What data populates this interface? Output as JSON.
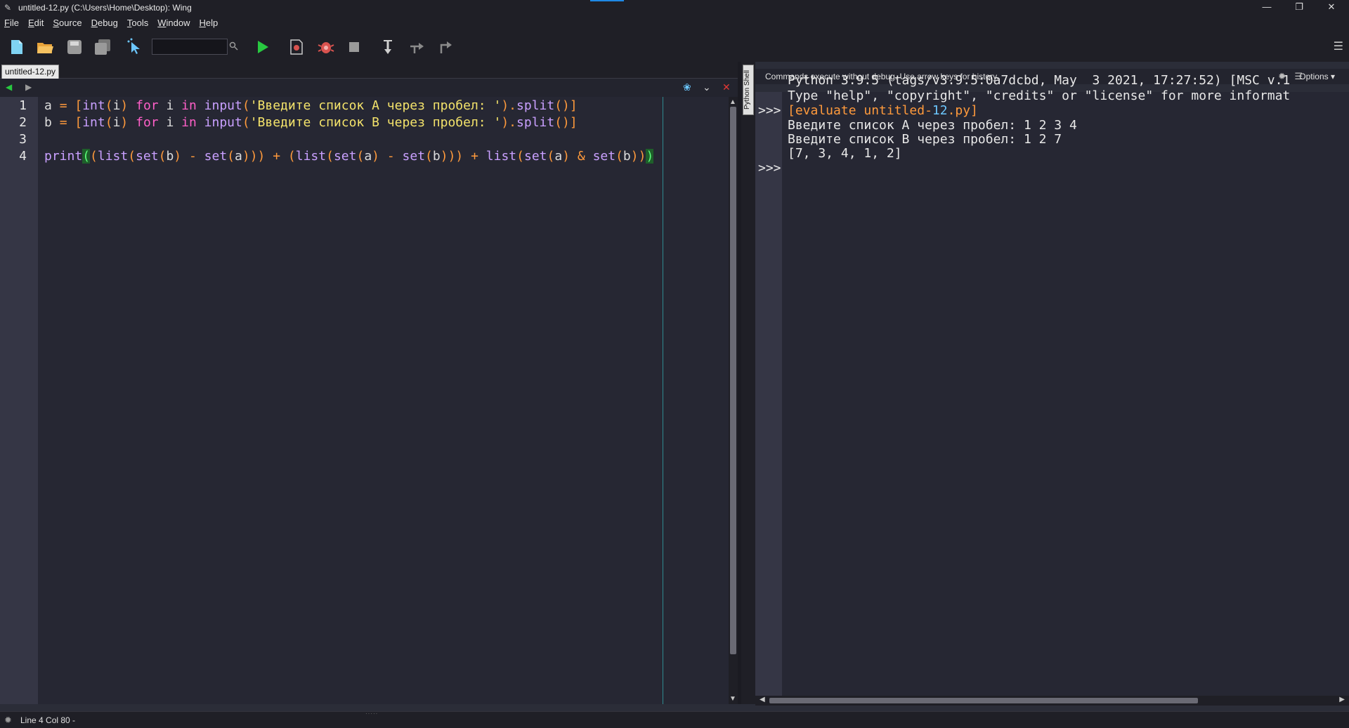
{
  "window": {
    "title": "untitled-12.py (C:\\Users\\Home\\Desktop): Wing",
    "controls": {
      "minimize": "—",
      "restore": "❐",
      "close": "✕"
    }
  },
  "menu": [
    "File",
    "Edit",
    "Source",
    "Debug",
    "Tools",
    "Window",
    "Help"
  ],
  "toolbar": {
    "search_value": "",
    "icons": [
      "new-file-icon",
      "open-folder-icon",
      "save-icon",
      "save-all-icon",
      "pointer-select-icon",
      "search-icon",
      "run-icon",
      "record-icon",
      "debug-bug-icon",
      "stop-icon",
      "step-into-icon",
      "step-over-icon",
      "step-out-icon",
      "hamburger-menu-icon"
    ],
    "colors": {
      "run": "#28c840",
      "debug": "#d9534f"
    }
  },
  "editor": {
    "tab_label": "untitled-12.py",
    "line_numbers": [
      "1",
      "2",
      "3",
      "4"
    ],
    "lines": [
      "a = [int(i) for i in input('Введите список A через пробел: ').split()]",
      "b = [int(i) for i in input('Введите список B через пробел: ').split()]",
      "",
      "print((list(set(b) - set(a))) + (list(set(a) - set(b))) + list(set(a) & set(b)))"
    ],
    "tokens": {
      "l1": [
        "a ",
        "= ",
        "[",
        "int",
        "(",
        "i",
        ") ",
        "for",
        " i ",
        "in",
        " ",
        "input",
        "(",
        "'Введите список A через пробел: '",
        ").",
        "split",
        "()",
        "]"
      ],
      "l2": [
        "b ",
        "= ",
        "[",
        "int",
        "(",
        "i",
        ") ",
        "for",
        " i ",
        "in",
        " ",
        "input",
        "(",
        "'Введите список B через пробел: '",
        ").",
        "split",
        "()",
        "]"
      ],
      "l4": [
        "print",
        "(",
        "(",
        "list",
        "(",
        "set",
        "(",
        "b",
        ") ",
        "- ",
        "set",
        "(",
        "a",
        "))) ",
        "+ ",
        "(",
        "list",
        "(",
        "set",
        "(",
        "a",
        ") ",
        "- ",
        "set",
        "(",
        "b",
        "))) ",
        "+ ",
        "list",
        "(",
        "set",
        "(",
        "a",
        ") ",
        "& ",
        "set",
        "(",
        "b",
        "))",
        ")"
      ]
    }
  },
  "shell": {
    "panel_label": "Python Shell",
    "header_message": "Commands execute without debug.  Use arrow keys for history.",
    "options_label": "Options",
    "prompt": ">>>",
    "output": [
      "Python 3.9.5 (tags/v3.9.5:0a7dcbd, May  3 2021, 17:27:52) [MSC v.1",
      "Type \"help\", \"copyright\", \"credits\" or \"license\" for more informat",
      "Введите список A через пробел: 1 2 3 4",
      "Введите список B через пробел: 1 2 7",
      "[7, 3, 4, 1, 2]"
    ],
    "evaluate_prefix": "[evaluate untitled-",
    "evaluate_num": "12",
    "evaluate_suffix": ".py]"
  },
  "status": {
    "text": "Line 4 Col 80 -"
  }
}
